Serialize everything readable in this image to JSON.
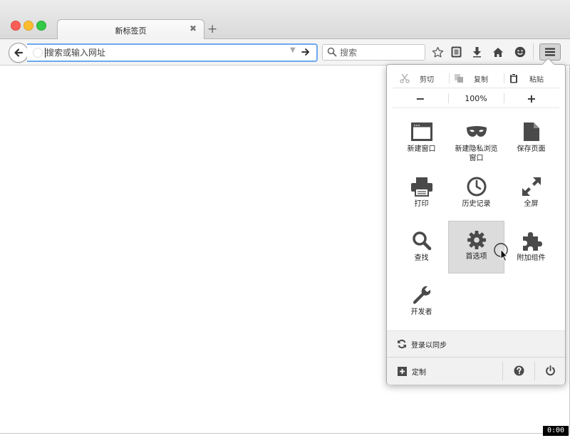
{
  "tab": {
    "title": "新标签页",
    "close_glyph": "✖",
    "new_tab_glyph": "+"
  },
  "toolbar": {
    "url_placeholder": "搜索或输入网址",
    "search_placeholder": "搜索"
  },
  "menu_panel": {
    "edit": {
      "cut": "剪切",
      "copy": "复制",
      "paste": "粘贴"
    },
    "zoom": {
      "out": "−",
      "value": "100%",
      "in": "+"
    },
    "items": [
      {
        "label": "新建窗口",
        "icon": "window-icon"
      },
      {
        "label": "新建隐私浏览窗口",
        "icon": "mask-icon"
      },
      {
        "label": "保存页面",
        "icon": "page-icon"
      },
      {
        "label": "打印",
        "icon": "printer-icon"
      },
      {
        "label": "历史记录",
        "icon": "clock-icon"
      },
      {
        "label": "全屏",
        "icon": "fullscreen-icon"
      },
      {
        "label": "查找",
        "icon": "search-icon"
      },
      {
        "label": "首选项",
        "icon": "gear-icon"
      },
      {
        "label": "附加组件",
        "icon": "puzzle-icon"
      },
      {
        "label": "开发者",
        "icon": "wrench-icon"
      }
    ],
    "sync": "登录以同步",
    "customize": "定制"
  },
  "timer": "0:00",
  "colors": {
    "accent_focus": "#6da8ee",
    "highlight": "#dcdcdc",
    "icon": "#4a4a4a"
  }
}
